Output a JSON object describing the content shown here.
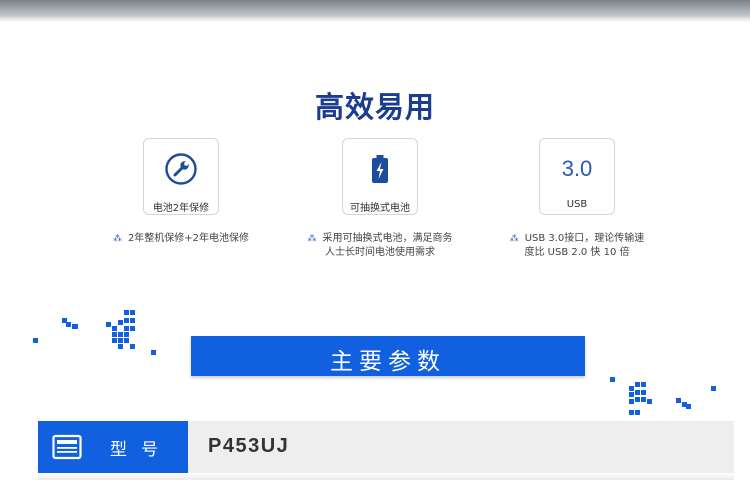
{
  "section": {
    "title": "高效易用"
  },
  "features": [
    {
      "card_label": "电池2年保修",
      "icon": "wrench-icon",
      "desc_lines": [
        "2年整机保修+2年电池保修"
      ]
    },
    {
      "card_label": "可抽换式电池",
      "icon": "battery-icon",
      "desc_lines": [
        "采用可抽换式电池，满足商务",
        "人士长时间电池使用需求"
      ]
    },
    {
      "card_label": "USB",
      "card_big": "3.0",
      "icon": "usb-version-text",
      "desc_lines": [
        "USB 3.0接口，理论传输速",
        "度比 USB 2.0 快 10 倍"
      ]
    }
  ],
  "specs": {
    "heading": "主要参数",
    "rows": [
      {
        "label": "型号",
        "value": "P453UJ",
        "icon": "monitor-icon"
      }
    ]
  },
  "colors": {
    "accent": "#1160e0",
    "title": "#1c3d8f",
    "card_border": "#d2d6dc"
  }
}
